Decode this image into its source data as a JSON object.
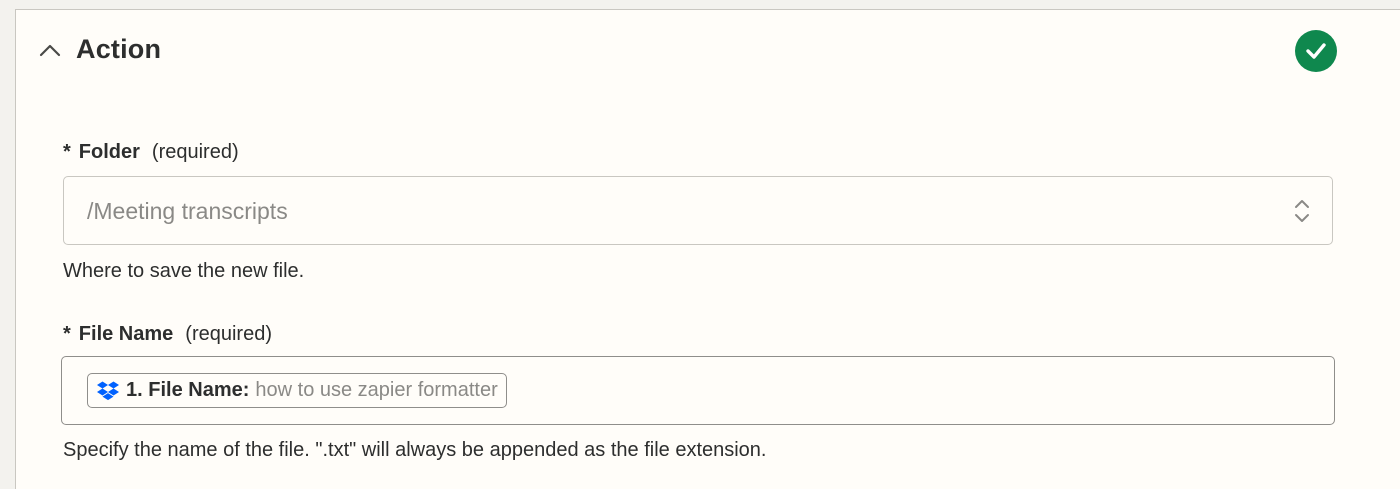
{
  "section": {
    "title": "Action",
    "status": "complete",
    "status_color": "#0f884e"
  },
  "folder_field": {
    "required_marker": "*",
    "label": "Folder",
    "required_text": "(required)",
    "value": "/Meeting transcripts",
    "help": "Where to save the new file."
  },
  "file_name_field": {
    "required_marker": "*",
    "label": "File Name",
    "required_text": "(required)",
    "pill": {
      "icon": "dropbox-icon",
      "icon_color": "#0061fe",
      "label": "1. File Name:",
      "value": "how to use zapier formatter"
    },
    "help": "Specify the name of the file. \".txt\" will always be appended as the file extension."
  }
}
